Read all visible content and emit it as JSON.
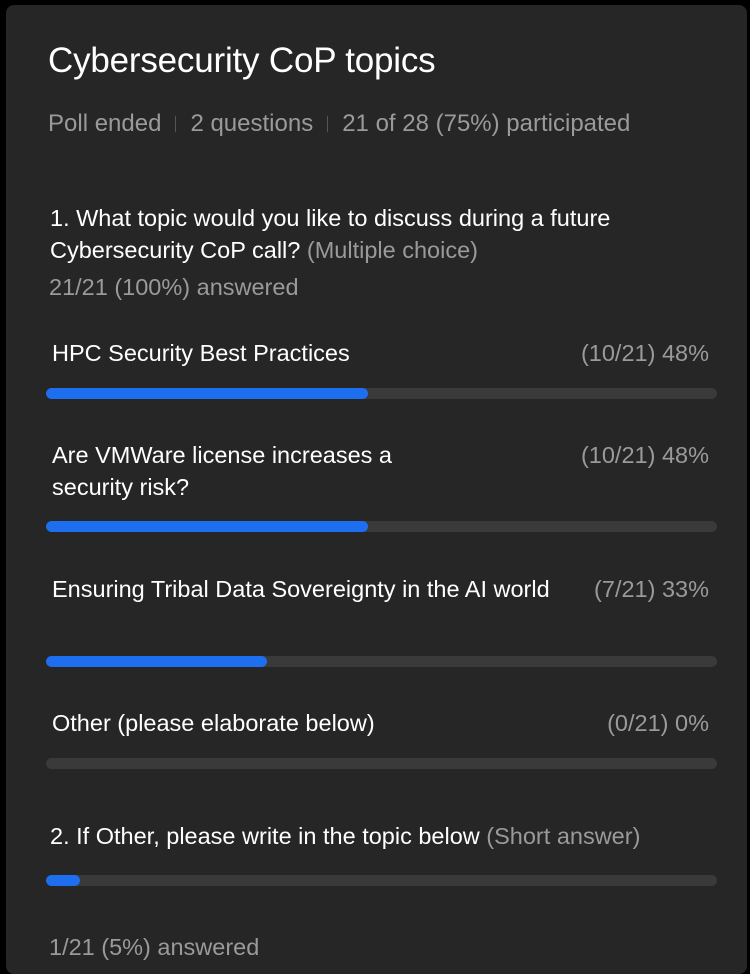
{
  "poll": {
    "title": "Cybersecurity CoP topics",
    "status": "Poll ended",
    "question_count": "2 questions",
    "participation": "21 of 28 (75%) participated"
  },
  "q1": {
    "text": "1. What topic would you like to discuss during a future Cybersecurity CoP call?",
    "type": "(Multiple choice)",
    "answered": "21/21 (100%) answered",
    "options": [
      {
        "label": "HPC Security Best Practices",
        "stat": "(10/21) 48%",
        "fraction": 0.48
      },
      {
        "label": "Are VMWare license increases a security risk?",
        "stat": "(10/21) 48%",
        "fraction": 0.48
      },
      {
        "label": "Ensuring Tribal Data Sovereignty in the AI world",
        "stat": "(7/21) 33%",
        "fraction": 0.33
      },
      {
        "label": "Other (please elaborate below)",
        "stat": "(0/21) 0%",
        "fraction": 0
      }
    ]
  },
  "q2": {
    "text": "2. If Other, please write in the topic below",
    "type": "(Short answer)",
    "answered": "1/21 (5%) answered",
    "fraction": 0.05
  },
  "colors": {
    "background": "#262626",
    "accent": "#1e6ff0",
    "track": "#3a3a3a",
    "muted_text": "#9a9a9a"
  }
}
